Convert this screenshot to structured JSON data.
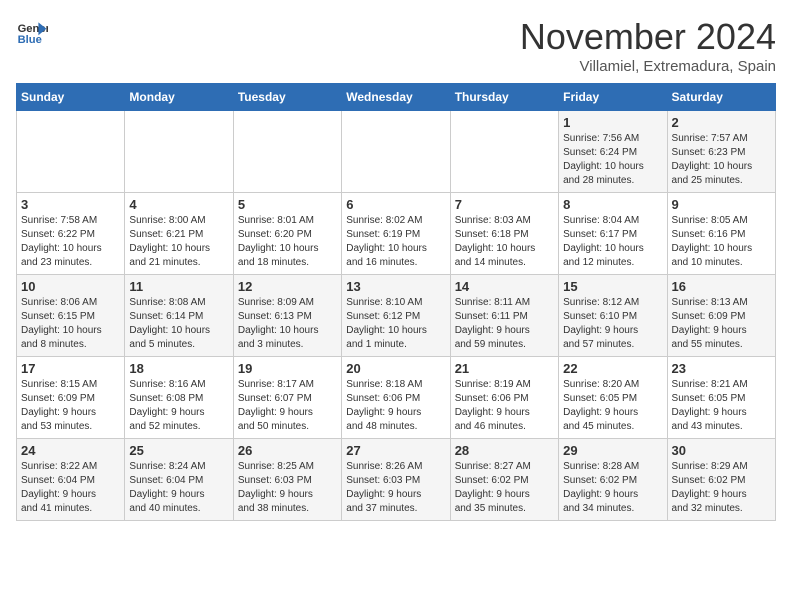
{
  "header": {
    "logo_line1": "General",
    "logo_line2": "Blue",
    "month": "November 2024",
    "location": "Villamiel, Extremadura, Spain"
  },
  "weekdays": [
    "Sunday",
    "Monday",
    "Tuesday",
    "Wednesday",
    "Thursday",
    "Friday",
    "Saturday"
  ],
  "weeks": [
    [
      {
        "day": "",
        "info": ""
      },
      {
        "day": "",
        "info": ""
      },
      {
        "day": "",
        "info": ""
      },
      {
        "day": "",
        "info": ""
      },
      {
        "day": "",
        "info": ""
      },
      {
        "day": "1",
        "info": "Sunrise: 7:56 AM\nSunset: 6:24 PM\nDaylight: 10 hours\nand 28 minutes."
      },
      {
        "day": "2",
        "info": "Sunrise: 7:57 AM\nSunset: 6:23 PM\nDaylight: 10 hours\nand 25 minutes."
      }
    ],
    [
      {
        "day": "3",
        "info": "Sunrise: 7:58 AM\nSunset: 6:22 PM\nDaylight: 10 hours\nand 23 minutes."
      },
      {
        "day": "4",
        "info": "Sunrise: 8:00 AM\nSunset: 6:21 PM\nDaylight: 10 hours\nand 21 minutes."
      },
      {
        "day": "5",
        "info": "Sunrise: 8:01 AM\nSunset: 6:20 PM\nDaylight: 10 hours\nand 18 minutes."
      },
      {
        "day": "6",
        "info": "Sunrise: 8:02 AM\nSunset: 6:19 PM\nDaylight: 10 hours\nand 16 minutes."
      },
      {
        "day": "7",
        "info": "Sunrise: 8:03 AM\nSunset: 6:18 PM\nDaylight: 10 hours\nand 14 minutes."
      },
      {
        "day": "8",
        "info": "Sunrise: 8:04 AM\nSunset: 6:17 PM\nDaylight: 10 hours\nand 12 minutes."
      },
      {
        "day": "9",
        "info": "Sunrise: 8:05 AM\nSunset: 6:16 PM\nDaylight: 10 hours\nand 10 minutes."
      }
    ],
    [
      {
        "day": "10",
        "info": "Sunrise: 8:06 AM\nSunset: 6:15 PM\nDaylight: 10 hours\nand 8 minutes."
      },
      {
        "day": "11",
        "info": "Sunrise: 8:08 AM\nSunset: 6:14 PM\nDaylight: 10 hours\nand 5 minutes."
      },
      {
        "day": "12",
        "info": "Sunrise: 8:09 AM\nSunset: 6:13 PM\nDaylight: 10 hours\nand 3 minutes."
      },
      {
        "day": "13",
        "info": "Sunrise: 8:10 AM\nSunset: 6:12 PM\nDaylight: 10 hours\nand 1 minute."
      },
      {
        "day": "14",
        "info": "Sunrise: 8:11 AM\nSunset: 6:11 PM\nDaylight: 9 hours\nand 59 minutes."
      },
      {
        "day": "15",
        "info": "Sunrise: 8:12 AM\nSunset: 6:10 PM\nDaylight: 9 hours\nand 57 minutes."
      },
      {
        "day": "16",
        "info": "Sunrise: 8:13 AM\nSunset: 6:09 PM\nDaylight: 9 hours\nand 55 minutes."
      }
    ],
    [
      {
        "day": "17",
        "info": "Sunrise: 8:15 AM\nSunset: 6:09 PM\nDaylight: 9 hours\nand 53 minutes."
      },
      {
        "day": "18",
        "info": "Sunrise: 8:16 AM\nSunset: 6:08 PM\nDaylight: 9 hours\nand 52 minutes."
      },
      {
        "day": "19",
        "info": "Sunrise: 8:17 AM\nSunset: 6:07 PM\nDaylight: 9 hours\nand 50 minutes."
      },
      {
        "day": "20",
        "info": "Sunrise: 8:18 AM\nSunset: 6:06 PM\nDaylight: 9 hours\nand 48 minutes."
      },
      {
        "day": "21",
        "info": "Sunrise: 8:19 AM\nSunset: 6:06 PM\nDaylight: 9 hours\nand 46 minutes."
      },
      {
        "day": "22",
        "info": "Sunrise: 8:20 AM\nSunset: 6:05 PM\nDaylight: 9 hours\nand 45 minutes."
      },
      {
        "day": "23",
        "info": "Sunrise: 8:21 AM\nSunset: 6:05 PM\nDaylight: 9 hours\nand 43 minutes."
      }
    ],
    [
      {
        "day": "24",
        "info": "Sunrise: 8:22 AM\nSunset: 6:04 PM\nDaylight: 9 hours\nand 41 minutes."
      },
      {
        "day": "25",
        "info": "Sunrise: 8:24 AM\nSunset: 6:04 PM\nDaylight: 9 hours\nand 40 minutes."
      },
      {
        "day": "26",
        "info": "Sunrise: 8:25 AM\nSunset: 6:03 PM\nDaylight: 9 hours\nand 38 minutes."
      },
      {
        "day": "27",
        "info": "Sunrise: 8:26 AM\nSunset: 6:03 PM\nDaylight: 9 hours\nand 37 minutes."
      },
      {
        "day": "28",
        "info": "Sunrise: 8:27 AM\nSunset: 6:02 PM\nDaylight: 9 hours\nand 35 minutes."
      },
      {
        "day": "29",
        "info": "Sunrise: 8:28 AM\nSunset: 6:02 PM\nDaylight: 9 hours\nand 34 minutes."
      },
      {
        "day": "30",
        "info": "Sunrise: 8:29 AM\nSunset: 6:02 PM\nDaylight: 9 hours\nand 32 minutes."
      }
    ]
  ]
}
